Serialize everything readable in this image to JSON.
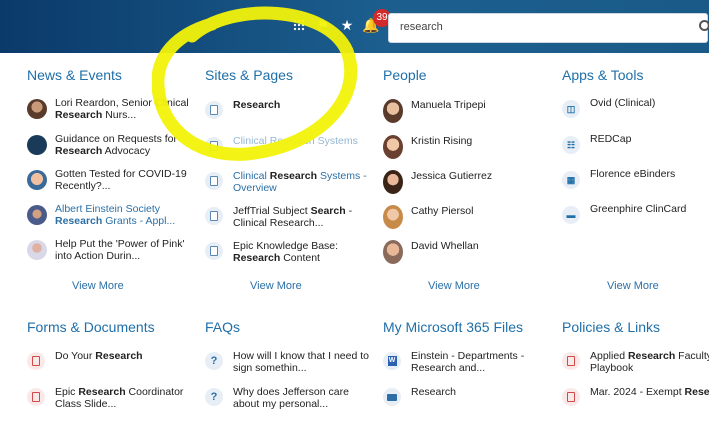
{
  "search": {
    "value": "research"
  },
  "header": {
    "notification_count": "39"
  },
  "sections": {
    "news": {
      "title": "News & Events",
      "items": [
        {
          "text": "Lori Reardon, Senior Clinical ",
          "bold": "Research",
          "text2": " Nurs..."
        },
        {
          "text": "Guidance on Requests for ",
          "bold": "Research",
          "text2": " Advocacy"
        },
        {
          "text": "Gotten Tested for COVID-19 Recently?...",
          "bold": "",
          "text2": ""
        },
        {
          "text": "Albert Einstein Society ",
          "bold": "Research",
          "text2": " Grants - Appl..."
        },
        {
          "text": "Help Put the 'Power of Pink' into Action Durin...",
          "bold": "",
          "text2": ""
        }
      ],
      "view_more": "View More"
    },
    "sites": {
      "title": "Sites & Pages",
      "items": [
        {
          "text": "",
          "bold": "Research",
          "text2": ""
        },
        {
          "text": "Clinical Research Systems",
          "bold": "",
          "text2": ""
        },
        {
          "text": "Clinical ",
          "bold": "Research",
          "text2": " Systems - Overview"
        },
        {
          "text": "JeffTrial Subject ",
          "bold": "Search",
          "text2": " - Clinical Research..."
        },
        {
          "text": "Epic Knowledge Base: ",
          "bold": "Research",
          "text2": " Content"
        }
      ],
      "view_more": "View More"
    },
    "people": {
      "title": "People",
      "items": [
        "Manuela Tripepi",
        "Kristin Rising",
        "Jessica Gutierrez",
        "Cathy Piersol",
        "David Whellan"
      ],
      "view_more": "View More"
    },
    "apps": {
      "title": "Apps & Tools",
      "items": [
        "Ovid (Clinical)",
        "REDCap",
        "Florence eBinders",
        "Greenphire ClinCard"
      ],
      "view_more": "View More"
    },
    "forms": {
      "title": "Forms & Documents",
      "items": [
        {
          "text": "Do Your ",
          "bold": "Research",
          "text2": ""
        },
        {
          "text": "Epic ",
          "bold": "Research",
          "text2": " Coordinator Class Slide..."
        }
      ]
    },
    "faqs": {
      "title": "FAQs",
      "items": [
        "How will I know that I need to sign somethin...",
        "Why does Jefferson care about my personal..."
      ]
    },
    "files": {
      "title": "My Microsoft 365 Files",
      "items": [
        "Einstein - Departments - Research and...",
        "Research"
      ]
    },
    "policies": {
      "title": "Policies & Links",
      "items": [
        {
          "text": "Applied ",
          "bold": "Research",
          "text2": " Faculty Playbook"
        },
        {
          "text": "Mar. 2024 - Exempt ",
          "bold": "Research",
          "text2": ""
        }
      ]
    }
  },
  "colors": {
    "accent": "#1f6fa8",
    "header": "#0a3a6a",
    "highlight": "#f2f20a"
  }
}
